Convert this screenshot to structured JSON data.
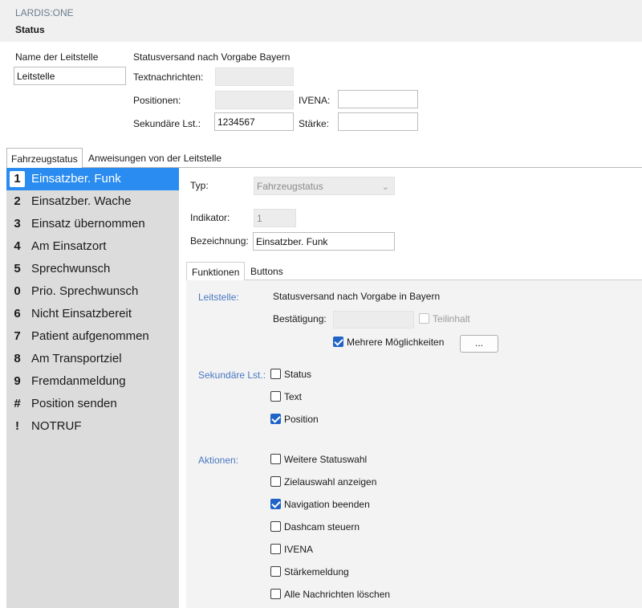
{
  "app": {
    "name": "LARDIS:ONE",
    "title": "Status"
  },
  "top": {
    "name_label": "Name der Leitstelle",
    "name_value": "Leitstelle",
    "statusversand_label": "Statusversand nach Vorgabe Bayern",
    "textnachrichten_label": "Textnachrichten:",
    "textnachrichten_value": "",
    "positionen_label": "Positionen:",
    "positionen_value": "",
    "ivena_label": "IVENA:",
    "ivena_value": "",
    "sekundaere_label": "Sekundäre Lst.:",
    "sekundaere_value": "1234567",
    "staerke_label": "Stärke:",
    "staerke_value": ""
  },
  "outer_tabs": [
    {
      "label": "Fahrzeugstatus",
      "active": true
    },
    {
      "label": "Anweisungen von der Leitstelle",
      "active": false
    }
  ],
  "status_list": [
    {
      "num": "1",
      "label": "Einsatzber. Funk",
      "active": true
    },
    {
      "num": "2",
      "label": "Einsatzber. Wache"
    },
    {
      "num": "3",
      "label": "Einsatz übernommen"
    },
    {
      "num": "4",
      "label": "Am Einsatzort"
    },
    {
      "num": "5",
      "label": "Sprechwunsch"
    },
    {
      "num": "0",
      "label": "Prio. Sprechwunsch"
    },
    {
      "num": "6",
      "label": "Nicht Einsatzbereit"
    },
    {
      "num": "7",
      "label": "Patient aufgenommen"
    },
    {
      "num": "8",
      "label": "Am Transportziel"
    },
    {
      "num": "9",
      "label": "Fremdanmeldung"
    },
    {
      "num": "#",
      "label": "Position senden"
    },
    {
      "num": "!",
      "label": "NOTRUF"
    }
  ],
  "detail": {
    "typ_label": "Typ:",
    "typ_value": "Fahrzeugstatus",
    "indikator_label": "Indikator:",
    "indikator_value": "1",
    "bezeichnung_label": "Bezeichnung:",
    "bezeichnung_value": "Einsatzber. Funk"
  },
  "inner_tabs": [
    {
      "label": "Funktionen",
      "active": true
    },
    {
      "label": "Buttons",
      "active": false
    }
  ],
  "funktionen": {
    "leitstelle_label": "Leitstelle:",
    "leitstelle_text": "Statusversand nach Vorgabe in Bayern",
    "bestaetigung_label": "Bestätigung:",
    "bestaetigung_value": "",
    "teilinhalt": {
      "label": "Teilinhalt",
      "checked": false,
      "disabled": true
    },
    "mehrere": {
      "label": "Mehrere Möglichkeiten",
      "checked": true
    },
    "more_button": "...",
    "sekundaere_label": "Sekundäre Lst.:",
    "sekundaere_options": [
      {
        "label": "Status",
        "checked": false
      },
      {
        "label": "Text",
        "checked": false
      },
      {
        "label": "Position",
        "checked": true
      }
    ],
    "aktionen_label": "Aktionen:",
    "aktionen_options": [
      {
        "label": "Weitere Statuswahl",
        "checked": false
      },
      {
        "label": "Zielauswahl anzeigen",
        "checked": false
      },
      {
        "label": "Navigation beenden",
        "checked": true
      },
      {
        "label": "Dashcam steuern",
        "checked": false
      },
      {
        "label": "IVENA",
        "checked": false
      },
      {
        "label": "Stärkemeldung",
        "checked": false
      },
      {
        "label": "Alle Nachrichten löschen",
        "checked": false
      }
    ]
  },
  "colors": {
    "accent": "#2a8cf0",
    "section_label": "#4a78c2",
    "checkbox_checked": "#1f63c6"
  }
}
